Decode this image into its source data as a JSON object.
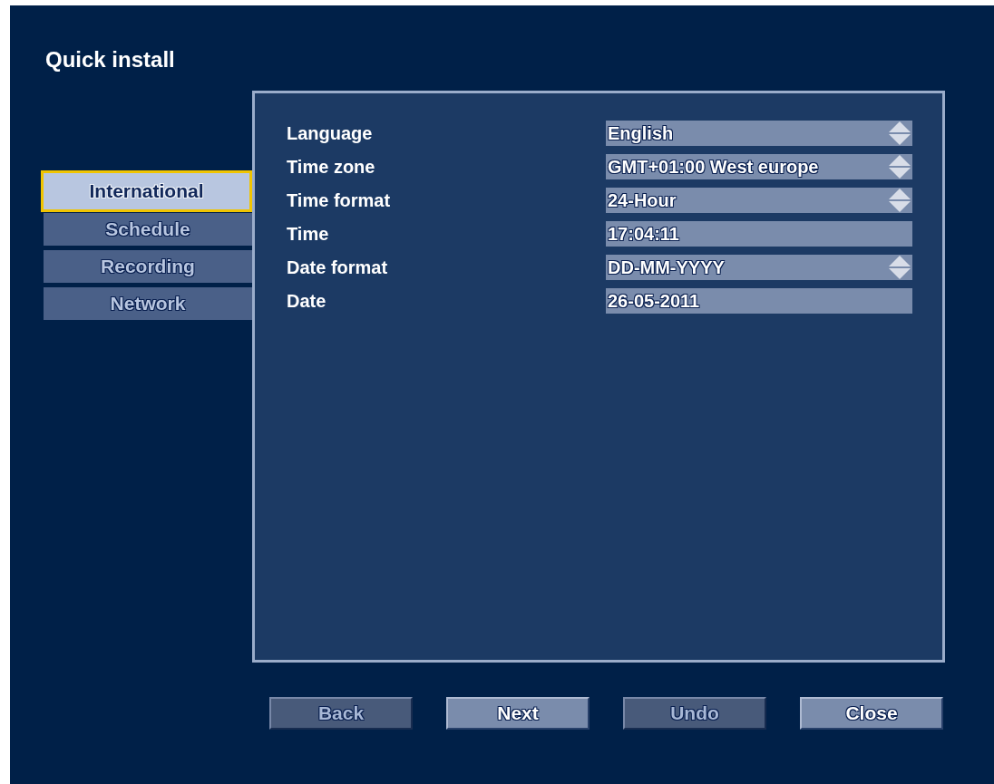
{
  "title": "Quick install",
  "tabs": [
    {
      "label": "International",
      "selected": true
    },
    {
      "label": "Schedule",
      "selected": false
    },
    {
      "label": "Recording",
      "selected": false
    },
    {
      "label": "Network",
      "selected": false
    }
  ],
  "settings": [
    {
      "label": "Language",
      "value": "English",
      "kind": "select"
    },
    {
      "label": "Time zone",
      "value": "GMT+01:00 West europe",
      "kind": "select"
    },
    {
      "label": "Time format",
      "value": "24-Hour",
      "kind": "select"
    },
    {
      "label": "Time",
      "value": "17:04:11",
      "kind": "text"
    },
    {
      "label": "Date format",
      "value": "DD-MM-YYYY",
      "kind": "select"
    },
    {
      "label": "Date",
      "value": "26-05-2011",
      "kind": "text"
    }
  ],
  "buttons": [
    {
      "label": "Back",
      "disabled": true
    },
    {
      "label": "Next",
      "disabled": false
    },
    {
      "label": "Undo",
      "disabled": true
    },
    {
      "label": "Close",
      "disabled": false
    }
  ]
}
